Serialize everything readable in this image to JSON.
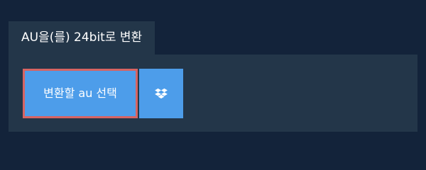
{
  "tab": {
    "title": "AU을(를) 24bit로 변환"
  },
  "actions": {
    "select_label": "변환할 au 선택",
    "dropbox_icon": "dropbox-icon"
  },
  "colors": {
    "background": "#13233a",
    "panel": "#233649",
    "button": "#4d9dea",
    "highlight_border": "#d76463"
  }
}
